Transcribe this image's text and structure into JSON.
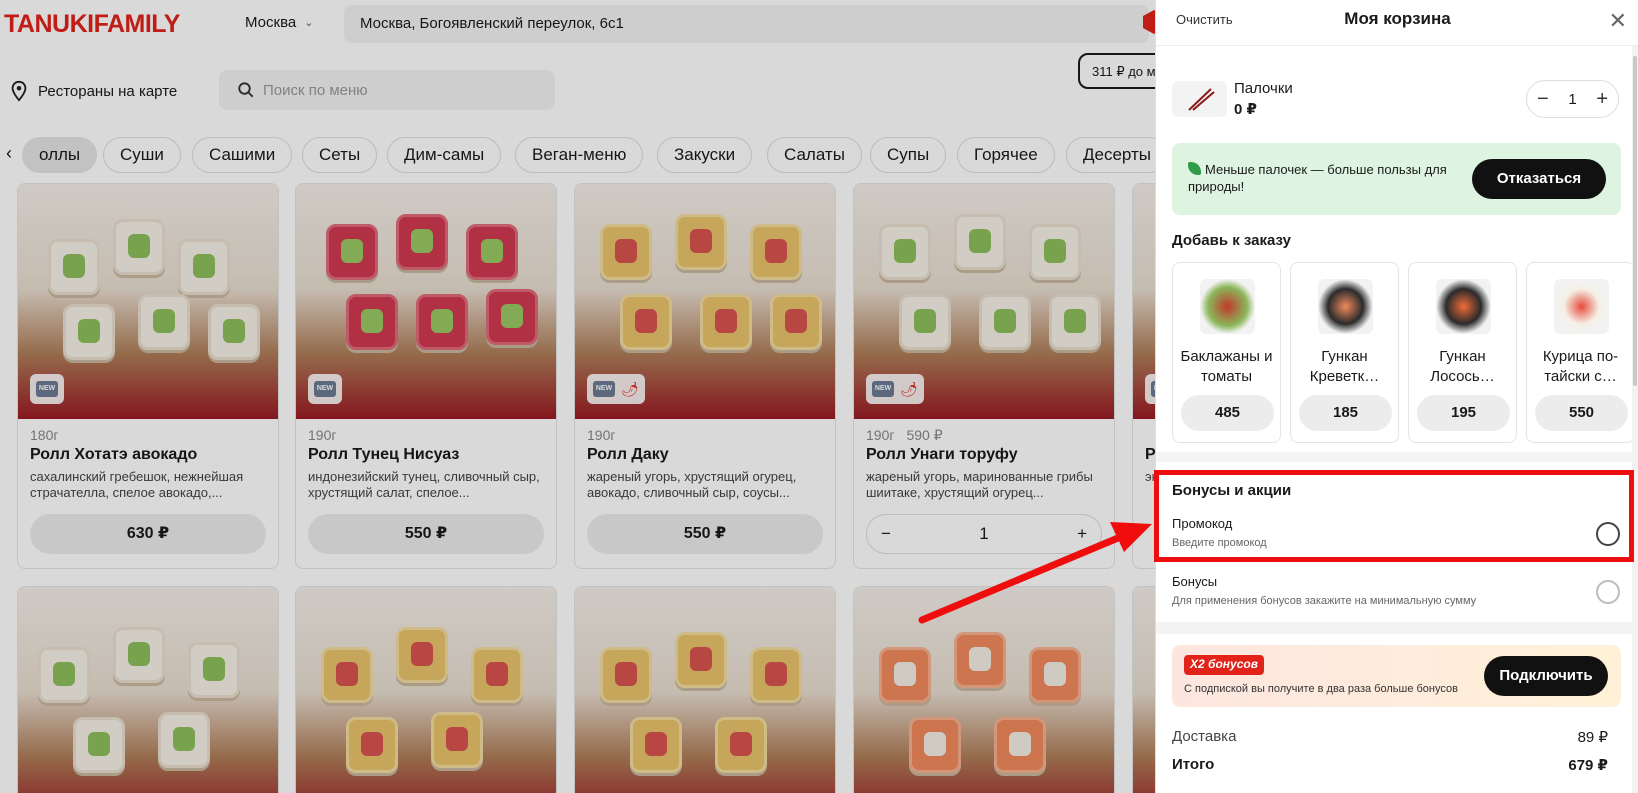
{
  "header": {
    "logo": "TANUKIFAMILY",
    "city": "Москва",
    "address": "Москва, Богоявленский переулок, 6с1"
  },
  "toolbar": {
    "map_label": "Рестораны на карте",
    "search_placeholder": "Поиск по меню",
    "min_badge": "311 ₽ до м"
  },
  "categories": [
    "оллы",
    "Суши",
    "Сашими",
    "Сеты",
    "Дим-самы",
    "Веган-меню",
    "Закуски",
    "Салаты",
    "Супы",
    "Горячее",
    "Десерты"
  ],
  "products": [
    {
      "weight": "180г",
      "old_price": "",
      "title": "Ролл Хотатэ авокадо",
      "desc": "сахалинский гребешок, нежнейшая страчателла, спелое авокадо,...",
      "price": "630 ₽",
      "qty": ""
    },
    {
      "weight": "190г",
      "old_price": "",
      "title": "Ролл Тунец Нисуаз",
      "desc": "индонезийский тунец, сливочный сыр, хрустящий салат, спелое...",
      "price": "550 ₽",
      "qty": ""
    },
    {
      "weight": "190г",
      "old_price": "",
      "title": "Ролл Даку",
      "desc": "жареный угорь, хрустящий огурец, авокадо, сливочный сыр, соусы...",
      "price": "550 ₽",
      "qty": ""
    },
    {
      "weight": "190г",
      "old_price": "590 ₽",
      "title": "Ролл Унаги торуфу",
      "desc": "жареный угорь, маринованные грибы шиитаке, хрустящий огурец...",
      "price": "",
      "qty": "1"
    }
  ],
  "partial_card": {
    "title": "Р",
    "desc": "эн"
  },
  "cart": {
    "clear_label": "Очистить",
    "title": "Моя корзина",
    "item": {
      "name": "Палочки",
      "price": "0 ₽",
      "qty": "1"
    },
    "eco_text": "Меньше палочек — больше пользы для природы!",
    "decline_label": "Отказаться",
    "add_title": "Добавь к заказу",
    "add_items": [
      {
        "name": "Баклажаны и томаты",
        "price": "485"
      },
      {
        "name": "Гункан Креветк…",
        "price": "185"
      },
      {
        "name": "Гункан Лосось…",
        "price": "195"
      },
      {
        "name": "Курица по-тайски с…",
        "price": "550"
      }
    ],
    "bonus_title": "Бонусы и акции",
    "promo_label": "Промокод",
    "promo_sub": "Введите промокод",
    "bonus_label": "Бонусы",
    "bonus_sub": "Для применения бонусов закажите на минимальную сумму",
    "x2_badge": "X2 бонусов",
    "x2_text": "С подпиской вы получите в два раза больше бонусов",
    "connect_label": "Подключить",
    "delivery_label": "Доставка",
    "delivery_value": "89 ₽",
    "total_label": "Итого",
    "total_value": "679 ₽"
  },
  "colors": {
    "brand": "#e2231a",
    "annotation": "#f00d0d",
    "eco_bg": "#dff3e1"
  }
}
